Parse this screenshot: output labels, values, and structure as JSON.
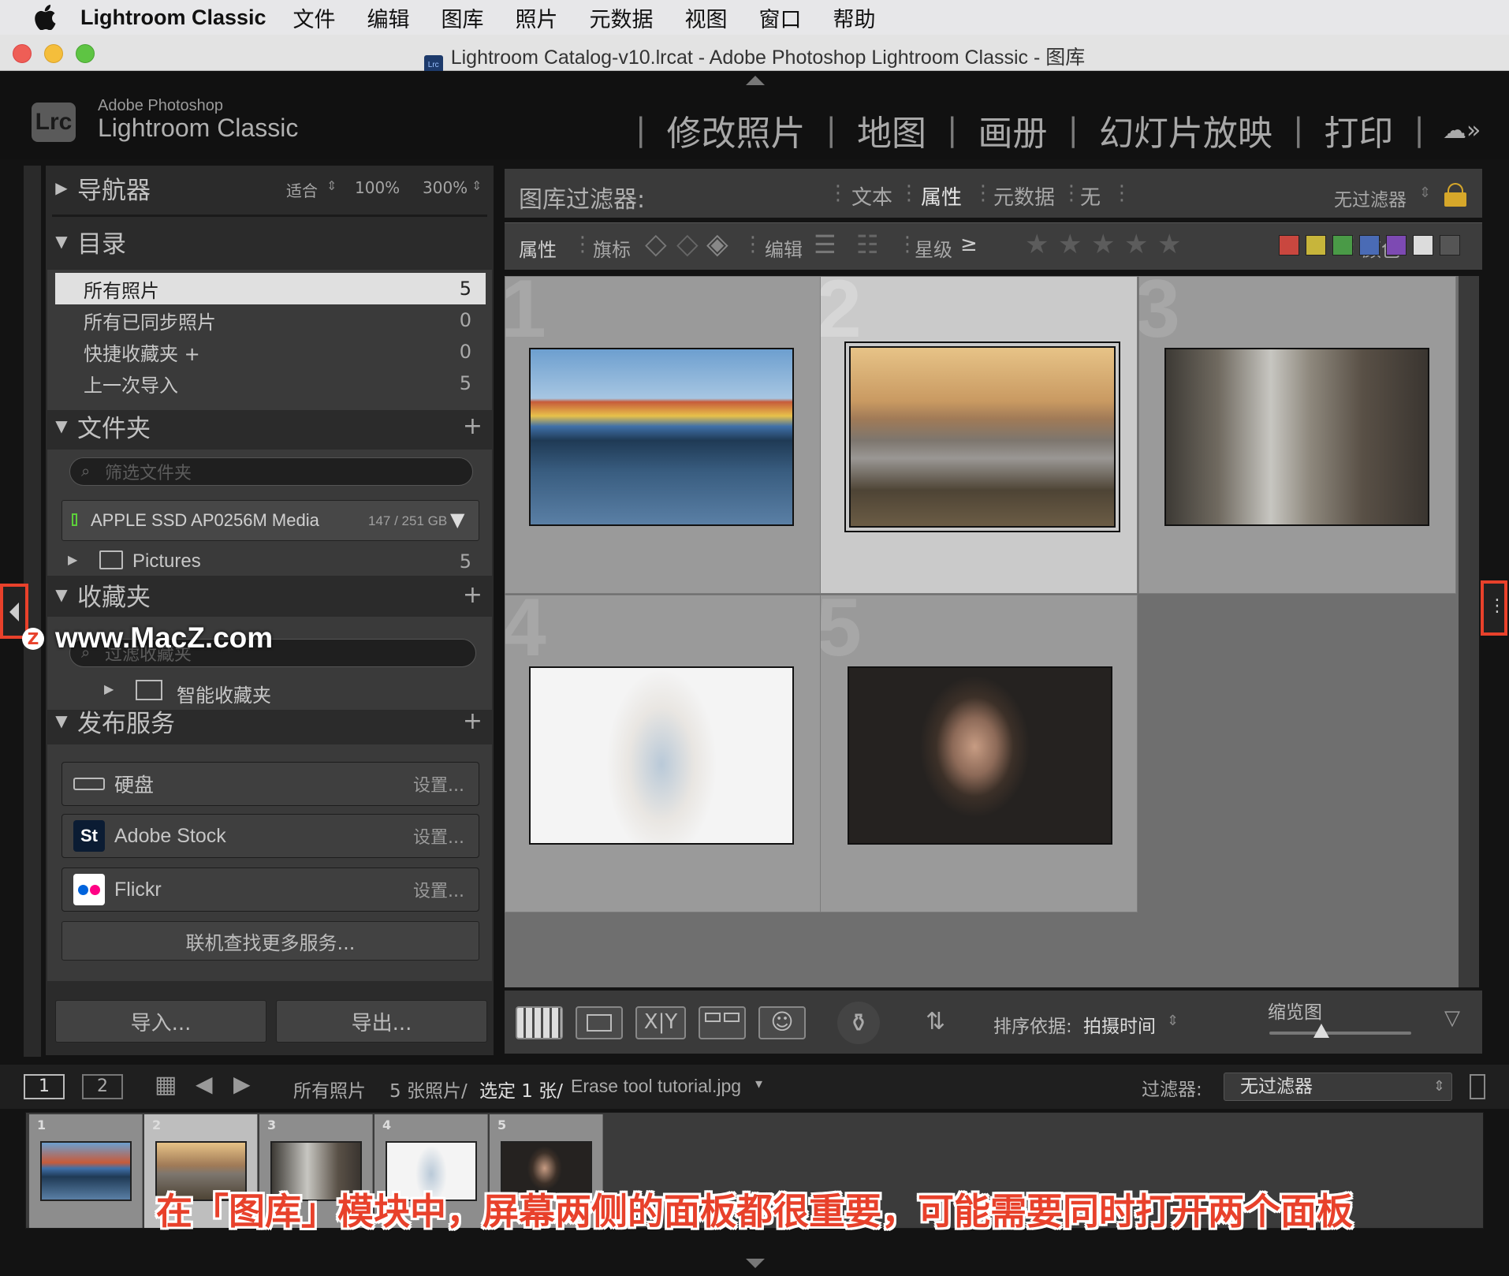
{
  "menubar": {
    "app": "Lightroom Classic",
    "items": [
      "文件",
      "编辑",
      "图库",
      "照片",
      "元数据",
      "视图",
      "窗口",
      "帮助"
    ]
  },
  "window": {
    "title": "Lightroom Catalog-v10.lrcat - Adobe Photoshop Lightroom Classic - 图库",
    "doc_icon": "Lrc"
  },
  "identity": {
    "logo": "Lrc",
    "line1": "Adobe Photoshop",
    "line2": "Lightroom Classic"
  },
  "modules": [
    "修改照片",
    "地图",
    "画册",
    "幻灯片放映",
    "打印"
  ],
  "navigator": {
    "title": "导航器",
    "zoom_fit": "适合",
    "zoom_100": "100%",
    "zoom_300": "300%"
  },
  "catalog": {
    "title": "目录",
    "items": [
      {
        "label": "所有照片",
        "count": "5"
      },
      {
        "label": "所有已同步照片",
        "count": "0"
      },
      {
        "label": "快捷收藏夹 +",
        "count": "0"
      },
      {
        "label": "上一次导入",
        "count": "5"
      }
    ]
  },
  "folders": {
    "title": "文件夹",
    "search_placeholder": "筛选文件夹",
    "volume": "APPLE SSD AP0256M Media",
    "volume_size": "147 / 251 GB",
    "folder": "Pictures",
    "folder_count": "5"
  },
  "collections": {
    "title": "收藏夹",
    "search_placeholder": "过滤收藏夹",
    "smart": "智能收藏夹"
  },
  "publish": {
    "title": "发布服务",
    "services": [
      {
        "name": "硬盘",
        "action": "设置..."
      },
      {
        "name": "Adobe Stock",
        "action": "设置..."
      },
      {
        "name": "Flickr",
        "action": "设置..."
      }
    ],
    "more": "联机查找更多服务..."
  },
  "buttons": {
    "import": "导入...",
    "export": "导出..."
  },
  "filter": {
    "title": "图库过滤器:",
    "tabs": [
      "文本",
      "属性",
      "元数据",
      "无"
    ],
    "preset": "无过滤器",
    "attr": "属性",
    "flag": "旗标",
    "edit": "编辑",
    "rating": "星级",
    "rating_op": "≥",
    "color": "颜色"
  },
  "colors": {
    "accent": "#e8412b",
    "red": "#c9473f",
    "yellow": "#c7b53b",
    "green": "#4a9a47",
    "blue": "#4a6bb5",
    "purple": "#7d4ab3",
    "white": "#dcdcdc",
    "gray": "#555555"
  },
  "grid": {
    "cells": [
      {
        "n": "1"
      },
      {
        "n": "2"
      },
      {
        "n": "3"
      },
      {
        "n": "4"
      },
      {
        "n": "5"
      }
    ]
  },
  "toolbar": {
    "sort_label": "排序依据:",
    "sort_value": "拍摄时间",
    "thumb_label": "缩览图"
  },
  "filmstrip": {
    "page1": "1",
    "page2": "2",
    "source": "所有照片",
    "count": "5 张照片/",
    "selected": "选定 1 张/",
    "filename": "Erase tool tutorial.jpg",
    "filter_label": "过滤器:",
    "filter_value": "无过滤器",
    "cells": [
      "1",
      "2",
      "3",
      "4",
      "5"
    ]
  },
  "watermark": "www.MacZ.com",
  "caption": "在「图库」模块中，屏幕两侧的面板都很重要，可能需要同时打开两个面板"
}
